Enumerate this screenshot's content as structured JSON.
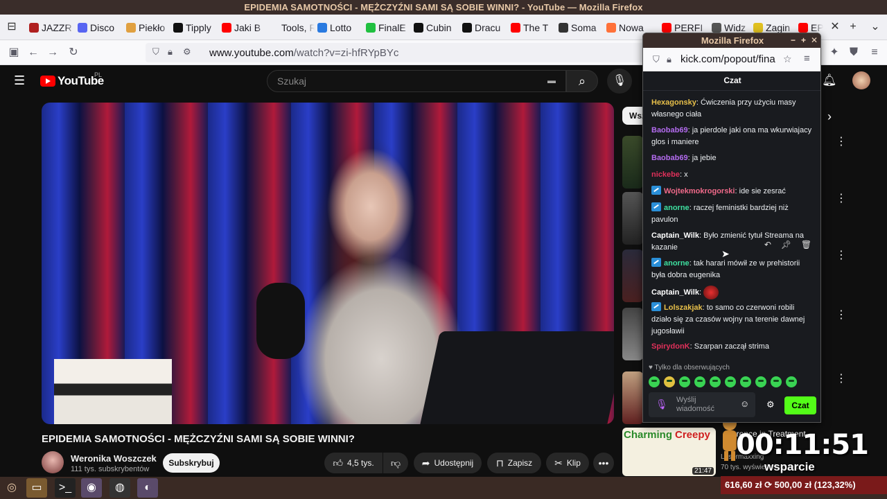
{
  "window": {
    "title": "EPIDEMIA SAMOTNOŚCI - MĘŻCZYŹNI SAMI SĄ SOBIE WINNI? - YouTube — Mozilla Firefox"
  },
  "tabs": [
    {
      "label": "JAZZR",
      "color": "#b02020"
    },
    {
      "label": "Disco",
      "color": "#5865f2"
    },
    {
      "label": "Piekło",
      "color": "#e0a040"
    },
    {
      "label": "Tipply",
      "color": "#111111"
    },
    {
      "label": "Jaki B",
      "color": "#ff0000"
    },
    {
      "label": "Tools, R",
      "color": "#f0f0f4"
    },
    {
      "label": "Lotto",
      "color": "#2a7ae0"
    },
    {
      "label": "FinalE",
      "color": "#20c040"
    },
    {
      "label": "Cubin",
      "color": "#111111"
    },
    {
      "label": "Dracu",
      "color": "#111111"
    },
    {
      "label": "The T",
      "color": "#ff0000"
    },
    {
      "label": "Soma",
      "color": "#333333"
    },
    {
      "label": "Nowa",
      "color": "#ff7139"
    },
    {
      "label": "PERFI",
      "color": "#ff0000"
    },
    {
      "label": "Widz",
      "color": "#555555"
    },
    {
      "label": "Zagin",
      "color": "#e0c020"
    },
    {
      "label": "EPI",
      "color": "#ff0000"
    }
  ],
  "nav": {
    "url_host": "www.youtube.com",
    "url_path": "/watch?v=zi-hfRYpBYc"
  },
  "youtube": {
    "logo": "YouTube",
    "country": "PL",
    "search_placeholder": "Szukaj",
    "video_title": "EPIDEMIA SAMOTNOŚCI - MĘŻCZYŹNI SAMI SĄ SOBIE WINNI?",
    "channel_name": "Weronika Woszczek",
    "channel_subs": "111 tys. subskrybentów",
    "subscribe_label": "Subskrybuj",
    "likes": "4,5 tys.",
    "share_label": "Udostępnij",
    "save_label": "Zapisz",
    "clip_label": "Klip",
    "chip_label": "Wsz",
    "bottom_rec": {
      "thumb_left": "Charming",
      "thumb_right": "Creepy",
      "duration": "21:47",
      "title": "erence in Treatment",
      "channel": "Losermaxxing",
      "meta": "70 tys. wyświetleń · 8 mie"
    }
  },
  "popup": {
    "title": "Mozilla Firefox",
    "url": "kick.com/popout/fina",
    "chat_title": "Czat",
    "messages": [
      {
        "user": "Hexagonsky",
        "color": "#e8c04a",
        "badge": false,
        "text": "Ćwiczenia przy użyciu masy własnego ciała"
      },
      {
        "user": "Baobab69",
        "color": "#b46cf0",
        "badge": false,
        "text": "ja pierdole jaki ona ma wkurwiajacy glos i maniere"
      },
      {
        "user": "Baobab69",
        "color": "#b46cf0",
        "badge": false,
        "text": "ja jebie"
      },
      {
        "user": "nickebe",
        "color": "#e0305a",
        "badge": false,
        "text": "x"
      },
      {
        "user": "Wojtekmokrogorski",
        "color": "#f06a8a",
        "badge": true,
        "text": "ide sie zesrać"
      },
      {
        "user": "anorne",
        "color": "#3ee0a0",
        "badge": true,
        "text": "raczej feministki bardziej niż pavulon"
      },
      {
        "user": "Captain_Wilk",
        "color": "#ffffff",
        "badge": false,
        "text": "Było zmienić tytuł Streama na kazanie"
      },
      {
        "user": "anorne",
        "color": "#3ee0a0",
        "badge": true,
        "text": "tak harari mówił ze w prehistorii była dobra eugenika"
      },
      {
        "user": "Captain_Wilk",
        "color": "#ffffff",
        "badge": false,
        "text": ""
      },
      {
        "user": "Lolszakjak",
        "color": "#e8c04a",
        "badge": true,
        "text": "to samo co czerwoni robili działo się za czasów wojny na terenie dawnej jugosławii"
      },
      {
        "user": "SpirydonK",
        "color": "#e0305a",
        "badge": false,
        "text": "Szarpan zaczął strima"
      }
    ],
    "followers_only": "Tylko dla obserwujących",
    "input_placeholder": "Wyślij wiadomość",
    "send_label": "Czat"
  },
  "overlay": {
    "timer": "00:11:51",
    "support": "wsparcie",
    "money": "616,60 zł ⟳ 500,00 zł (123,32%)"
  },
  "colors": {
    "kick_green": "#53fc18",
    "yt_red": "#ff0000"
  }
}
